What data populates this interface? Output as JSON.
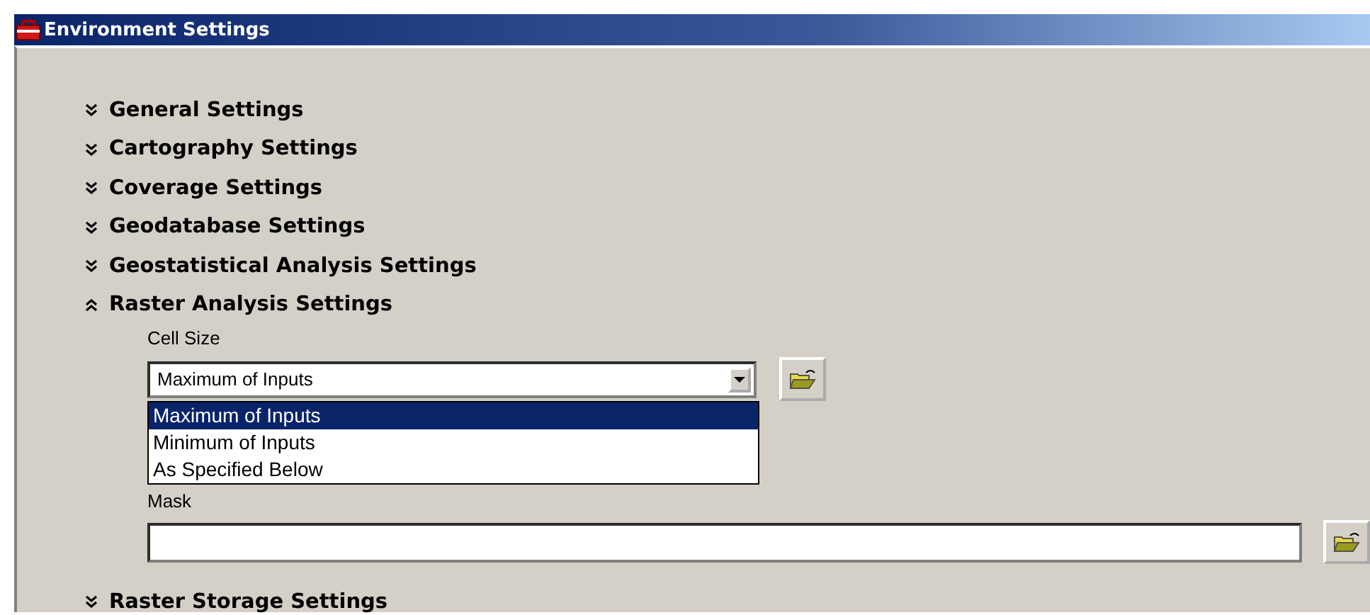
{
  "window": {
    "title": "Environment Settings"
  },
  "sections": [
    {
      "label": "General Settings",
      "expanded": false
    },
    {
      "label": "Cartography Settings",
      "expanded": false
    },
    {
      "label": "Coverage Settings",
      "expanded": false
    },
    {
      "label": "Geodatabase Settings",
      "expanded": false
    },
    {
      "label": "Geostatistical Analysis Settings",
      "expanded": false
    },
    {
      "label": "Raster Analysis Settings",
      "expanded": true,
      "fields": {
        "cell_size": {
          "label": "Cell Size",
          "value": "Maximum of Inputs",
          "options": [
            {
              "label": "Maximum of Inputs",
              "selected": true
            },
            {
              "label": "Minimum of Inputs",
              "selected": false
            },
            {
              "label": "As Specified Below",
              "selected": false
            }
          ]
        },
        "mask": {
          "label": "Mask"
        }
      }
    },
    {
      "label": "Raster Storage Settings",
      "expanded": false
    }
  ]
}
